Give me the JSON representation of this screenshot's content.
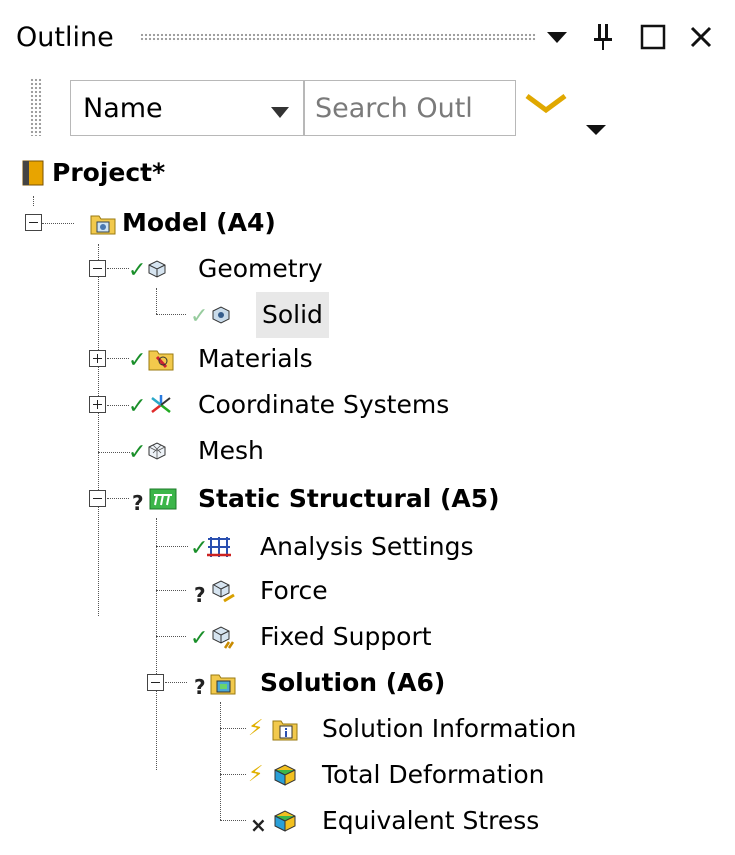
{
  "panel": {
    "title": "Outline",
    "controls": [
      "dropdown-icon",
      "pin-icon",
      "maximize-icon",
      "close-icon"
    ]
  },
  "toolbar": {
    "filter_value": "Name",
    "search_placeholder": "Search Outl",
    "filter_icon": "chevron-filter-icon"
  },
  "tree": {
    "project": "Project*",
    "model": "Model (A4)",
    "geometry": "Geometry",
    "solid": "Solid",
    "materials": "Materials",
    "coordinate_systems": "Coordinate Systems",
    "mesh": "Mesh",
    "static_structural": "Static Structural (A5)",
    "analysis_settings": "Analysis Settings",
    "force": "Force",
    "fixed_support": "Fixed Support",
    "solution": "Solution (A6)",
    "solution_information": "Solution Information",
    "total_deformation": "Total Deformation",
    "equivalent_stress": "Equivalent Stress"
  },
  "status_symbols": {
    "ok": "✓",
    "unknown": "?",
    "pending": "⚡",
    "failed": "×"
  },
  "colors": {
    "check": "#1a8f2a",
    "bolt": "#e0b000",
    "folder": "#f2c94c",
    "filter_chevron": "#e0a800"
  }
}
